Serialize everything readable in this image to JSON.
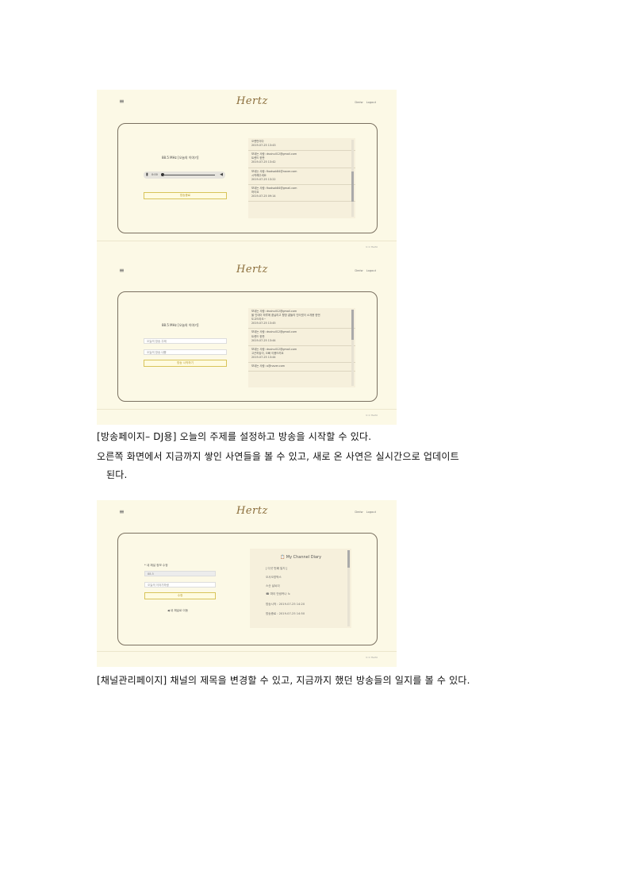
{
  "common": {
    "menu_icon": "≡",
    "logo": "Hertz",
    "toplink_1": "Dedw",
    "toplink_2": "Logout",
    "footer": "⊙ ⊙ Hertz"
  },
  "shot1": {
    "freq_label": "88.5 MHz [오늘의 이야기]",
    "player_icon": "menu-icon",
    "player_time": "0:00",
    "button": "방송종료",
    "messages": [
      {
        "line1": "오랜만이다",
        "line2": "2019-07-25 13:43"
      },
      {
        "line1": "보내는 사람: dssinull12@gmail.com",
        "line2": "트렌드 한판",
        "line3": "2019-07-25 13:42"
      },
      {
        "line1": "보내는 사람: fkadsak84@naver.com",
        "line2": "시작해주세요",
        "line3": "2019-07-25 13:22"
      },
      {
        "line1": "보내는 사람: fkadsak84@gmail.com",
        "line2": "하이요",
        "line3": "2019-07-25 09:14"
      }
    ]
  },
  "shot2": {
    "freq_label": "88.5 MHz [오늘의 이야기]",
    "input_1": "오늘의 방송 주제",
    "input_2": "오늘의 방송 내용",
    "button": "방송 시작하기",
    "messages": [
      {
        "line1": "보내는 사람: dssinull12@gmail.com",
        "line2": "올 인데이 하루에 흩날리고 향방 끝들의 인터넷이 소개용 한번",
        "line3": "도고드라오~",
        "line4": "2019-07-25 13:45"
      },
      {
        "line1": "보내는 사람: dssinull12@gmail.com",
        "line2": "트렌드 한판",
        "line3": "2019-07-25 13:44"
      },
      {
        "line1": "보내는 사람: dssinull12@gmail.com",
        "line2": "고곤하놓이, 오빠 이용드려요",
        "line3": "2019-07-25 13:44"
      },
      {
        "line1": "보내는 사람: a@naver.com"
      }
    ]
  },
  "shot3": {
    "form_label": "* 내 채널 정보 수정",
    "input_1": "88.5",
    "input_2": "오늘의 이야기하람",
    "button": "수정",
    "back_link": "◀ 내 채널로 이동",
    "diary_title": "📋 My Channel Diary",
    "diary_lines": [
      "[ 다섯 번째 일지 ]",
      "오사오방박스",
      "스산 날씨이",
      "☎ 파이 안녕커나 노",
      "방송시작 : 2019-07-25 14:20",
      "방송종료 : 2019-07-25 14:50"
    ]
  },
  "captions": {
    "line1": "[방송페이지– DJ용] 오늘의 주제를 설정하고 방송을 시작할 수 있다.",
    "line2": "오른쪽 화면에서 지금까지 쌓인 사연들을 볼 수 있고, 새로 온 사연은 실시간으로 업데이트",
    "line3": "된다.",
    "line4": "[채널관리페이지] 채널의 제목을 변경할 수 있고, 지금까지 했던 방송들의 일지를 볼 수 있다."
  }
}
